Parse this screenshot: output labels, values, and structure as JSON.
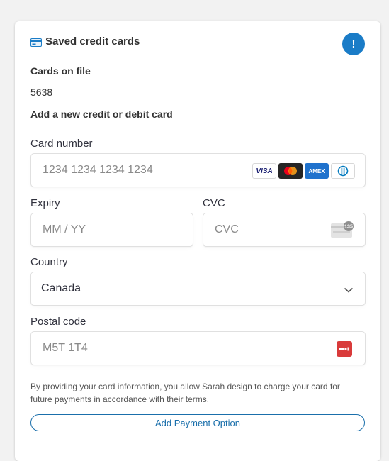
{
  "header": {
    "title": "Saved credit cards",
    "icon": "credit-card-icon",
    "info_button": "!"
  },
  "cards_on_file": {
    "title": "Cards on file",
    "cards": [
      "5638"
    ]
  },
  "new_card": {
    "title": "Add a new credit or debit card",
    "card_number": {
      "label": "Card number",
      "placeholder": "1234 1234 1234 1234",
      "brands": [
        "VISA",
        "mastercard",
        "AMEX",
        "diners"
      ]
    },
    "expiry": {
      "label": "Expiry",
      "placeholder": "MM / YY"
    },
    "cvc": {
      "label": "CVC",
      "placeholder": "CVC",
      "hint_number": "135"
    },
    "country": {
      "label": "Country",
      "value": "Canada"
    },
    "postal_code": {
      "label": "Postal code",
      "placeholder": "M5T 1T4"
    }
  },
  "disclaimer": "By providing your card information, you allow Sarah design to charge your card for future payments in accordance with their terms.",
  "add_button_label": "Add Payment Option",
  "colors": {
    "accent": "#1a7cc7",
    "button_border": "#1a6fab",
    "postal_icon": "#d93a3a"
  }
}
